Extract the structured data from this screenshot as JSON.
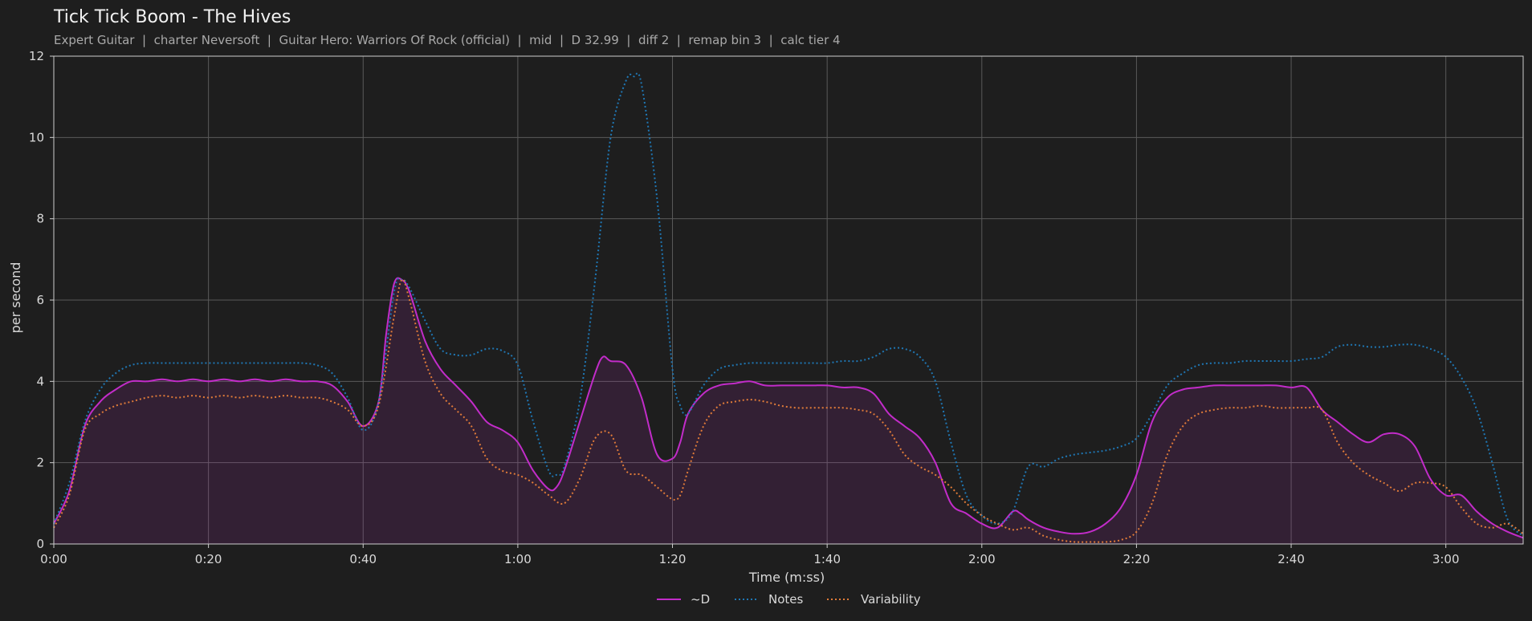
{
  "chart_data": {
    "type": "line",
    "title": "Tick Tick Boom - The Hives",
    "subtitle": "Expert Guitar  |  charter Neversoft  |  Guitar Hero: Warriors Of Rock (official)  |  mid  |  D 32.99  |  diff 2  |  remap bin 3  |  calc tier 4",
    "xlabel": "Time (m:ss)",
    "ylabel": "per second",
    "xlim": [
      0,
      190
    ],
    "ylim": [
      0,
      12
    ],
    "xticks": [
      0,
      20,
      40,
      60,
      80,
      100,
      120,
      140,
      160,
      180
    ],
    "xtick_labels": [
      "0:00",
      "0:20",
      "0:40",
      "1:00",
      "1:20",
      "1:40",
      "2:00",
      "2:20",
      "2:40",
      "3:00"
    ],
    "yticks": [
      0,
      2,
      4,
      6,
      8,
      10,
      12
    ],
    "ytick_labels": [
      "0",
      "2",
      "4",
      "6",
      "8",
      "10",
      "12"
    ],
    "grid": true,
    "legend": "bottom-center",
    "series": [
      {
        "name": "~D",
        "color": "#c22cc9",
        "style": "solid",
        "fill": true,
        "x": [
          0,
          2,
          4,
          6,
          8,
          10,
          12,
          14,
          16,
          18,
          20,
          22,
          24,
          26,
          28,
          30,
          32,
          34,
          36,
          38,
          40,
          42,
          43,
          44,
          45,
          46,
          48,
          50,
          52,
          54,
          56,
          58,
          60,
          62,
          64,
          65,
          66,
          68,
          70,
          71,
          72,
          74,
          76,
          78,
          80,
          81,
          82,
          84,
          86,
          88,
          90,
          92,
          94,
          96,
          98,
          100,
          102,
          104,
          106,
          108,
          110,
          112,
          114,
          116,
          118,
          120,
          122,
          124,
          125,
          126,
          128,
          130,
          132,
          134,
          136,
          138,
          140,
          142,
          144,
          146,
          148,
          150,
          152,
          154,
          156,
          158,
          160,
          162,
          164,
          166,
          168,
          170,
          172,
          174,
          176,
          178,
          180,
          182,
          184,
          186,
          188,
          190
        ],
        "values": [
          0.5,
          1.3,
          2.9,
          3.5,
          3.8,
          4.0,
          4.0,
          4.05,
          4.0,
          4.05,
          4.0,
          4.05,
          4.0,
          4.05,
          4.0,
          4.05,
          4.0,
          4.0,
          3.9,
          3.5,
          2.9,
          3.5,
          5.2,
          6.4,
          6.5,
          6.2,
          5.0,
          4.3,
          3.9,
          3.5,
          3.0,
          2.8,
          2.5,
          1.8,
          1.35,
          1.4,
          1.8,
          3.0,
          4.2,
          4.6,
          4.5,
          4.4,
          3.6,
          2.2,
          2.1,
          2.5,
          3.2,
          3.7,
          3.9,
          3.95,
          4.0,
          3.9,
          3.9,
          3.9,
          3.9,
          3.9,
          3.85,
          3.85,
          3.7,
          3.2,
          2.9,
          2.6,
          2.0,
          1.0,
          0.75,
          0.5,
          0.4,
          0.8,
          0.75,
          0.6,
          0.4,
          0.3,
          0.25,
          0.3,
          0.5,
          0.9,
          1.7,
          3.0,
          3.6,
          3.8,
          3.85,
          3.9,
          3.9,
          3.9,
          3.9,
          3.9,
          3.85,
          3.85,
          3.3,
          3.0,
          2.7,
          2.5,
          2.7,
          2.7,
          2.4,
          1.6,
          1.2,
          1.2,
          0.8,
          0.5,
          0.3,
          0.15
        ]
      },
      {
        "name": "Notes",
        "color": "#1f77b4",
        "style": "dotted",
        "fill": false,
        "x": [
          0,
          2,
          4,
          6,
          8,
          10,
          12,
          14,
          16,
          18,
          20,
          22,
          24,
          26,
          28,
          30,
          32,
          34,
          36,
          38,
          40,
          42,
          44,
          45,
          46,
          48,
          50,
          52,
          54,
          56,
          58,
          60,
          62,
          64,
          65,
          66,
          68,
          70,
          72,
          74,
          75,
          76,
          78,
          80,
          81,
          82,
          84,
          86,
          88,
          90,
          92,
          94,
          96,
          98,
          100,
          102,
          104,
          106,
          108,
          110,
          112,
          114,
          116,
          118,
          120,
          122,
          124,
          126,
          128,
          130,
          132,
          134,
          136,
          138,
          140,
          142,
          144,
          146,
          148,
          150,
          152,
          154,
          156,
          158,
          160,
          162,
          164,
          166,
          168,
          170,
          172,
          174,
          176,
          178,
          180,
          182,
          184,
          186,
          188,
          190
        ],
        "values": [
          0.5,
          1.5,
          3.0,
          3.8,
          4.2,
          4.4,
          4.45,
          4.45,
          4.45,
          4.45,
          4.45,
          4.45,
          4.45,
          4.45,
          4.45,
          4.45,
          4.45,
          4.4,
          4.2,
          3.6,
          2.8,
          3.5,
          6.2,
          6.5,
          6.3,
          5.5,
          4.8,
          4.65,
          4.65,
          4.8,
          4.75,
          4.4,
          3.0,
          1.8,
          1.7,
          1.9,
          3.5,
          6.5,
          10.0,
          11.4,
          11.5,
          11.3,
          8.5,
          4.3,
          3.4,
          3.2,
          3.9,
          4.3,
          4.4,
          4.45,
          4.45,
          4.45,
          4.45,
          4.45,
          4.45,
          4.5,
          4.5,
          4.6,
          4.8,
          4.8,
          4.6,
          4.0,
          2.5,
          1.2,
          0.7,
          0.5,
          0.8,
          1.9,
          1.9,
          2.1,
          2.2,
          2.25,
          2.3,
          2.4,
          2.6,
          3.2,
          3.9,
          4.2,
          4.4,
          4.45,
          4.45,
          4.5,
          4.5,
          4.5,
          4.5,
          4.55,
          4.6,
          4.85,
          4.9,
          4.85,
          4.85,
          4.9,
          4.9,
          4.8,
          4.6,
          4.1,
          3.3,
          2.0,
          0.6,
          0.2
        ]
      },
      {
        "name": "Variability",
        "color": "#e07b39",
        "style": "dotted",
        "fill": false,
        "x": [
          0,
          2,
          4,
          6,
          8,
          10,
          12,
          14,
          16,
          18,
          20,
          22,
          24,
          26,
          28,
          30,
          32,
          34,
          36,
          38,
          40,
          42,
          44,
          45,
          46,
          48,
          50,
          52,
          54,
          56,
          58,
          60,
          62,
          64,
          66,
          68,
          70,
          72,
          74,
          76,
          78,
          80,
          81,
          82,
          84,
          86,
          88,
          90,
          92,
          94,
          96,
          98,
          100,
          102,
          104,
          106,
          108,
          110,
          112,
          114,
          116,
          118,
          120,
          122,
          124,
          126,
          128,
          130,
          132,
          134,
          136,
          138,
          140,
          142,
          144,
          146,
          148,
          150,
          152,
          154,
          156,
          158,
          160,
          162,
          164,
          166,
          168,
          170,
          172,
          174,
          176,
          178,
          180,
          182,
          184,
          186,
          188,
          190
        ],
        "values": [
          0.4,
          1.2,
          2.8,
          3.2,
          3.4,
          3.5,
          3.6,
          3.65,
          3.6,
          3.65,
          3.6,
          3.65,
          3.6,
          3.65,
          3.6,
          3.65,
          3.6,
          3.6,
          3.5,
          3.3,
          2.9,
          3.4,
          5.6,
          6.5,
          6.0,
          4.5,
          3.7,
          3.3,
          2.9,
          2.1,
          1.8,
          1.7,
          1.5,
          1.2,
          1.0,
          1.6,
          2.6,
          2.7,
          1.8,
          1.7,
          1.4,
          1.1,
          1.2,
          1.8,
          2.9,
          3.4,
          3.5,
          3.55,
          3.5,
          3.4,
          3.35,
          3.35,
          3.35,
          3.35,
          3.3,
          3.2,
          2.8,
          2.2,
          1.9,
          1.7,
          1.4,
          1.0,
          0.7,
          0.5,
          0.35,
          0.4,
          0.2,
          0.1,
          0.05,
          0.05,
          0.05,
          0.1,
          0.3,
          1.0,
          2.2,
          2.9,
          3.2,
          3.3,
          3.35,
          3.35,
          3.4,
          3.35,
          3.35,
          3.35,
          3.3,
          2.5,
          2.0,
          1.7,
          1.5,
          1.3,
          1.5,
          1.5,
          1.4,
          0.9,
          0.5,
          0.4,
          0.5,
          0.25
        ]
      }
    ]
  }
}
